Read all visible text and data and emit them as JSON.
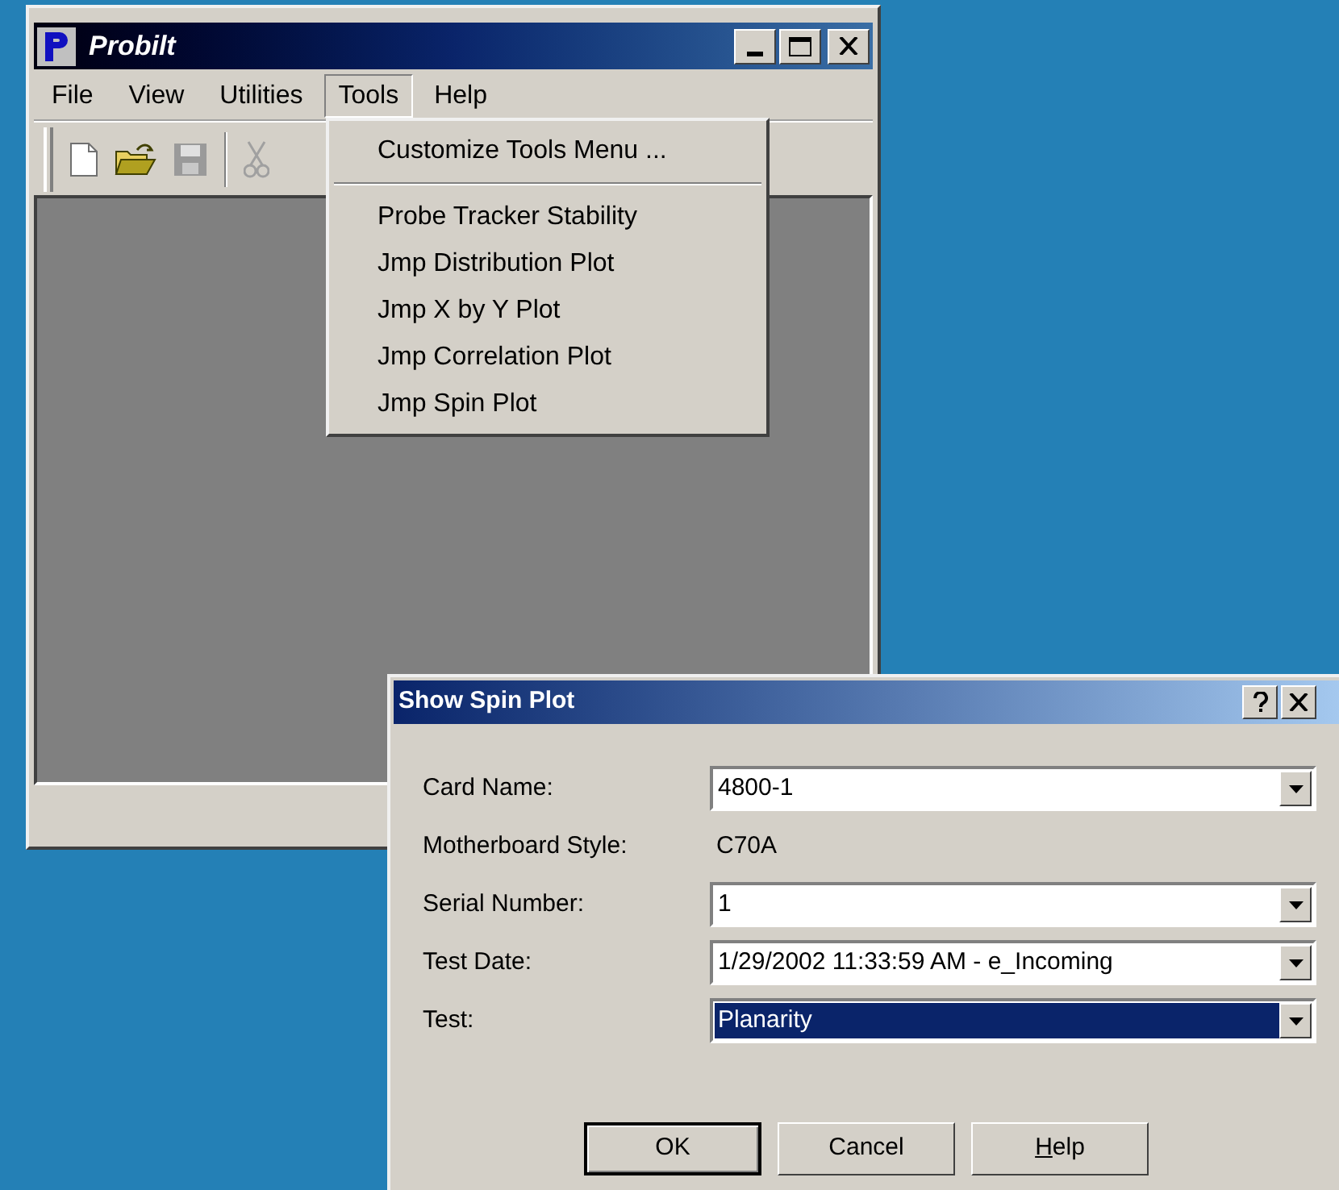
{
  "main_window": {
    "title": "Probilt",
    "menu_bar": [
      {
        "label": "File",
        "selected": false
      },
      {
        "label": "View",
        "selected": false
      },
      {
        "label": "Utilities",
        "selected": false
      },
      {
        "label": "Tools",
        "selected": true
      },
      {
        "label": "Help",
        "selected": false
      }
    ],
    "toolbar": [
      {
        "kind": "new",
        "disabled": false
      },
      {
        "kind": "open",
        "disabled": false
      },
      {
        "kind": "save",
        "disabled": true
      },
      {
        "kind": "separator"
      },
      {
        "kind": "cut",
        "disabled": true
      }
    ],
    "tools_menu": [
      {
        "kind": "item",
        "label": "Customize Tools Menu ..."
      },
      {
        "kind": "separator"
      },
      {
        "kind": "item",
        "label": "Probe Tracker Stability"
      },
      {
        "kind": "item",
        "label": "Jmp Distribution Plot"
      },
      {
        "kind": "item",
        "label": "Jmp X by Y Plot"
      },
      {
        "kind": "item",
        "label": "Jmp Correlation Plot"
      },
      {
        "kind": "item",
        "label": "Jmp Spin Plot"
      }
    ]
  },
  "dialog": {
    "title": "Show Spin Plot",
    "fields": [
      {
        "kind": "combo",
        "label": "Card Name:",
        "value": "4800-1",
        "highlighted": false
      },
      {
        "kind": "static",
        "label": "Motherboard Style:",
        "value": "C70A"
      },
      {
        "kind": "combo",
        "label": "Serial Number:",
        "value": "1",
        "highlighted": false
      },
      {
        "kind": "combo",
        "label": "Test Date:",
        "value": "1/29/2002 11:33:59 AM - e_Incoming",
        "highlighted": false
      },
      {
        "kind": "combo",
        "label": "Test:",
        "value": "Planarity",
        "highlighted": true
      }
    ],
    "buttons": [
      {
        "label": "OK",
        "default": true
      },
      {
        "label": "Cancel",
        "default": false
      },
      {
        "label": "Help",
        "default": false,
        "mnemonic": true
      }
    ]
  }
}
